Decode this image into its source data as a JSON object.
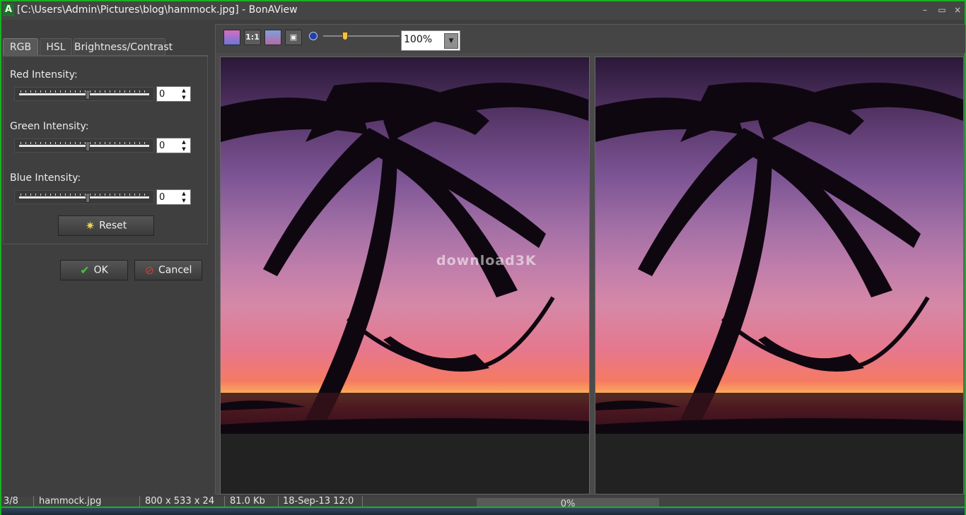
{
  "window": {
    "title": "[C:\\Users\\Admin\\Pictures\\blog\\hammock.jpg] - BonAView",
    "app_icon_glyph": "A",
    "minimize_glyph": "–",
    "maximize_glyph": "▭",
    "close_glyph": "×"
  },
  "tabs": [
    {
      "label": "RGB",
      "active": true
    },
    {
      "label": "HSL",
      "active": false
    },
    {
      "label": "Brightness/Contrast",
      "active": false
    }
  ],
  "rgb": {
    "red_label": "Red Intensity:",
    "red_value": "0",
    "green_label": "Green Intensity:",
    "green_value": "0",
    "blue_label": "Blue Intensity:",
    "blue_value": "0",
    "reset_label": "Reset",
    "reset_icon": "sun-icon"
  },
  "dialog": {
    "ok_label": "OK",
    "cancel_label": "Cancel"
  },
  "toolbar": {
    "btn_1_icon": "image-icon",
    "btn_2_label": "1:1",
    "btn_3_icon": "fit-icon",
    "btn_4_icon": "frame-icon",
    "zoom_value": "100%",
    "zoom_level": 0.27
  },
  "viewer": {
    "watermark": "download3K"
  },
  "statusbar": {
    "index": "3/8",
    "filename": "hammock.jpg",
    "dimensions": "800 x 533 x 24",
    "size": "81.0 Kb",
    "date": "18-Sep-13 12:0",
    "progress": "0%"
  },
  "colors": {
    "accent_border": "#16b31f",
    "panel_bg": "#3f3f3f"
  }
}
